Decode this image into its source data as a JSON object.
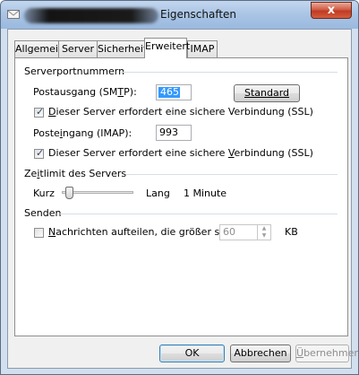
{
  "window": {
    "title": "Eigenschaften",
    "close_glyph": "x"
  },
  "tabs": [
    {
      "label": "Allgemein"
    },
    {
      "label": "Server"
    },
    {
      "label": "Sicherheit"
    },
    {
      "label": "Erweitert",
      "active": true
    },
    {
      "label": "IMAP"
    }
  ],
  "ports": {
    "group_label": "Serverportnummern",
    "smtp_label": "Postausgang (SMTP):",
    "smtp_value": "465",
    "standard_button": "Standard",
    "smtp_ssl_label": "Dieser Server erfordert eine sichere Verbindung (SSL)",
    "smtp_ssl_checked": true,
    "imap_label": "Posteingang (IMAP):",
    "imap_value": "993",
    "imap_ssl_label": "Dieser Server erfordert eine sichere Verbindung (SSL)",
    "imap_ssl_checked": true
  },
  "timeout": {
    "group_label": "Zeitlimit des Servers",
    "short_label": "Kurz",
    "long_label": "Lang",
    "value_label": "1 Minute",
    "slider_level": 0.05
  },
  "send": {
    "group_label": "Senden",
    "split_label": "Nachrichten aufteilen, die größer sind als",
    "split_checked": false,
    "split_value": "60",
    "unit_label": "KB"
  },
  "buttons": {
    "ok": "OK",
    "cancel": "Abbrechen",
    "apply": "Übernehmen"
  },
  "colors": {
    "title_bar": "#a9c4e4",
    "close_button": "#c9452c",
    "selection": "#3399ff"
  }
}
